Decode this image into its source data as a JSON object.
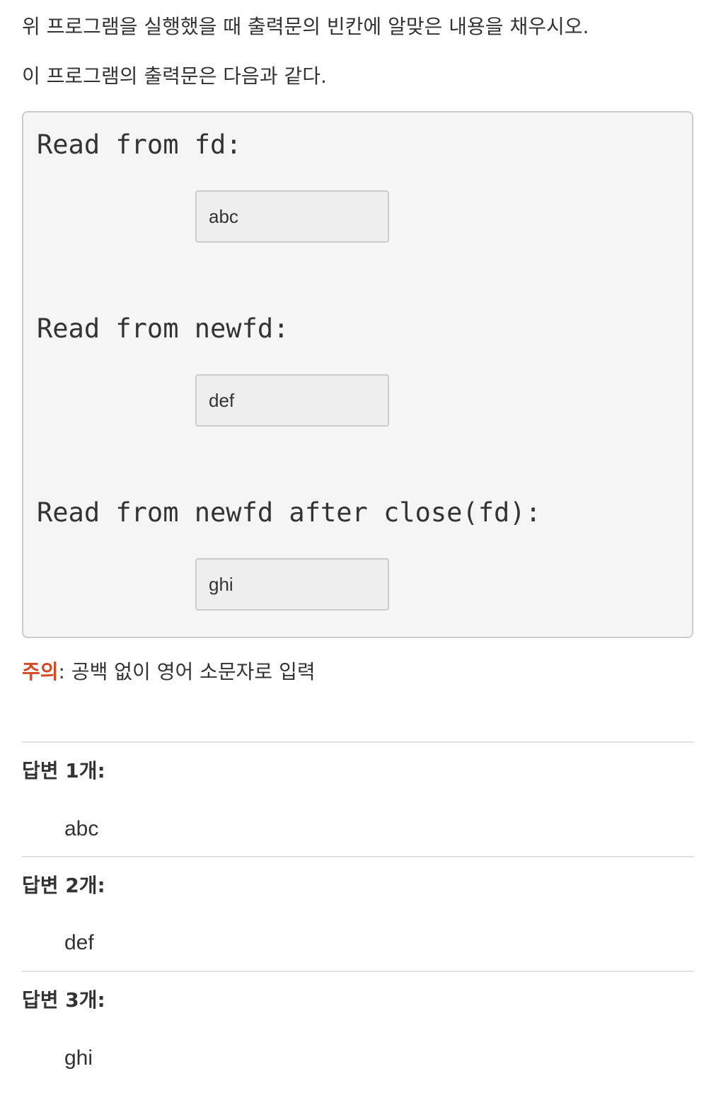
{
  "question": {
    "instruction": "위 프로그램을 실행했을 때 출력문의 빈칸에 알맞은 내용을 채우시오.",
    "output_intro": "이 프로그램의 출력문은 다음과 같다."
  },
  "output_block": {
    "lines": [
      {
        "code": "Read from fd:",
        "blank_value": "abc"
      },
      {
        "code": "Read from newfd:",
        "blank_value": "def"
      },
      {
        "code": "Read from newfd after close(fd):",
        "blank_value": "ghi"
      }
    ]
  },
  "note": {
    "label": "주의",
    "text": ": 공백 없이 영어 소문자로 입력"
  },
  "answers": [
    {
      "label": "답변 1개:",
      "value": "abc"
    },
    {
      "label": "답변 2개:",
      "value": "def"
    },
    {
      "label": "답변 3개:",
      "value": "ghi"
    }
  ],
  "colors": {
    "note_label": "#d44a26",
    "box_background": "#f5f5f5",
    "blank_background": "#eeeeee",
    "border": "#cccccc",
    "text": "#333333"
  }
}
